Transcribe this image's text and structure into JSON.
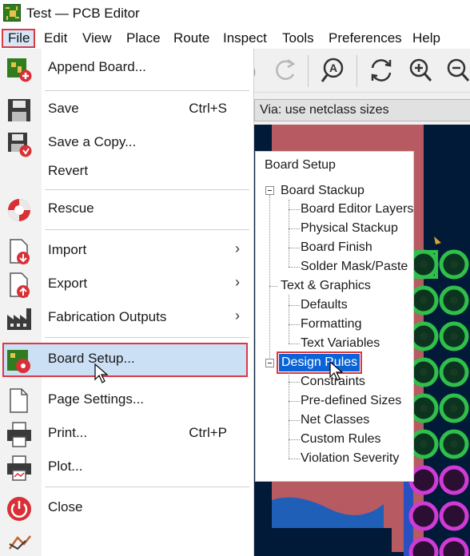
{
  "window": {
    "title": "Test — PCB Editor",
    "app_icon": "kicad-pcb-icon"
  },
  "menubar": {
    "items": [
      {
        "label": "File",
        "active": true
      },
      {
        "label": "Edit"
      },
      {
        "label": "View"
      },
      {
        "label": "Place"
      },
      {
        "label": "Route"
      },
      {
        "label": "Inspect"
      },
      {
        "label": "Tools"
      },
      {
        "label": "Preferences"
      },
      {
        "label": "Help"
      }
    ]
  },
  "toolbar": {
    "icons": [
      "redo-icon",
      "find-icon",
      "refresh-icon",
      "zoom-in-icon",
      "zoom-out-icon"
    ]
  },
  "via_select": {
    "value": "Via: use netclass sizes"
  },
  "file_menu": {
    "items": [
      {
        "label": "Append Board...",
        "icon": "append-board-icon"
      },
      {
        "label": "Save",
        "shortcut": "Ctrl+S",
        "icon": "save-icon"
      },
      {
        "label": "Save a Copy...",
        "icon": "save-copy-icon"
      },
      {
        "label": "Revert",
        "icon": ""
      },
      {
        "label": "Rescue",
        "icon": "rescue-icon"
      },
      {
        "label": "Import",
        "submenu": true,
        "icon": "import-icon"
      },
      {
        "label": "Export",
        "submenu": true,
        "icon": "export-icon"
      },
      {
        "label": "Fabrication Outputs",
        "submenu": true,
        "icon": "fabrication-icon"
      },
      {
        "label": "Board Setup...",
        "highlighted": true,
        "icon": "board-setup-icon"
      },
      {
        "label": "Page Settings...",
        "icon": "page-settings-icon"
      },
      {
        "label": "Print...",
        "shortcut": "Ctrl+P",
        "icon": "print-icon"
      },
      {
        "label": "Plot...",
        "icon": "plot-icon"
      },
      {
        "label": "Close",
        "icon": "close-icon"
      }
    ],
    "submenu_arrow": "›"
  },
  "board_setup_tree": {
    "title": "Board Setup",
    "groups": [
      {
        "label": "Board Stackup",
        "children": [
          "Board Editor Layers",
          "Physical Stackup",
          "Board Finish",
          "Solder Mask/Paste"
        ]
      },
      {
        "label": "Text & Graphics",
        "children": [
          "Defaults",
          "Formatting",
          "Text Variables"
        ]
      },
      {
        "label": "Design Rules",
        "selected": true,
        "children": [
          "Constraints",
          "Pre-defined Sizes",
          "Net Classes",
          "Custom Rules",
          "Violation Severity"
        ]
      }
    ]
  },
  "colors": {
    "accent_red": "#d93a44",
    "selection_blue": "#0a64d8",
    "canvas_bg": "#001a38",
    "pad_green": "#2fbf4a",
    "pad_magenta": "#d23ad6",
    "board_edge": "#b75a62"
  }
}
